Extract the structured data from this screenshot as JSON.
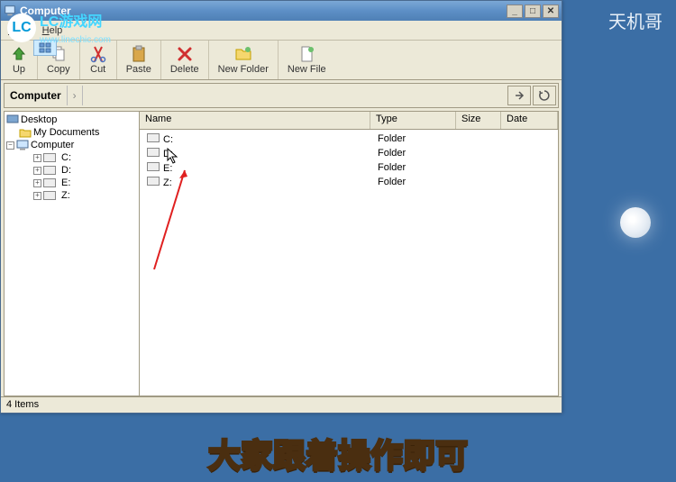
{
  "watermark": {
    "logo_text": "LC",
    "title": "LC游戏网",
    "url": "www.linechic.com"
  },
  "top_right": "天机哥",
  "window": {
    "title": "Computer",
    "menu": {
      "view": "View",
      "help": "Help"
    },
    "toolbar": {
      "up": "Up",
      "copy": "Copy",
      "cut": "Cut",
      "paste": "Paste",
      "delete": "Delete",
      "newfolder": "New Folder",
      "newfile": "New File"
    },
    "address": {
      "segment": "Computer"
    },
    "tree": {
      "desktop": "Desktop",
      "mydocs": "My Documents",
      "computer": "Computer",
      "drives": [
        "C:",
        "D:",
        "E:",
        "Z:"
      ]
    },
    "list": {
      "headers": {
        "name": "Name",
        "type": "Type",
        "size": "Size",
        "date": "Date"
      },
      "rows": [
        {
          "name": "C:",
          "type": "Folder"
        },
        {
          "name": "D:",
          "type": "Folder"
        },
        {
          "name": "E:",
          "type": "Folder"
        },
        {
          "name": "Z:",
          "type": "Folder"
        }
      ]
    },
    "status": "4 Items"
  },
  "caption": "大家跟着操作即可"
}
